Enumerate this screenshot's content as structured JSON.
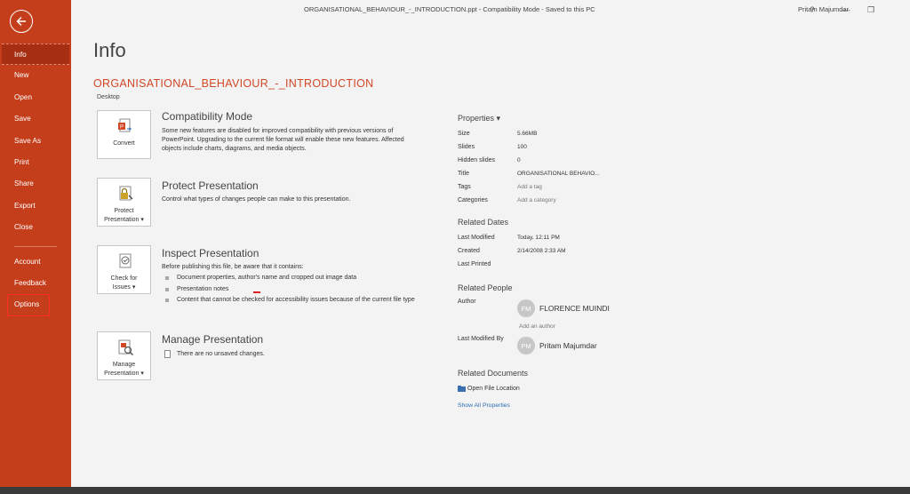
{
  "window": {
    "title": "ORGANISATIONAL_BEHAVIOUR_-_INTRODUCTION.ppt  -  Compatibility Mode  -  Saved to this PC",
    "user": "Pritam Majumdar",
    "help_label": "?",
    "minimize_label": "—",
    "restore_label": "❐"
  },
  "sidebar": {
    "items": [
      {
        "label": "Info"
      },
      {
        "label": "New"
      },
      {
        "label": "Open"
      },
      {
        "label": "Save"
      },
      {
        "label": "Save As"
      },
      {
        "label": "Print"
      },
      {
        "label": "Share"
      },
      {
        "label": "Export"
      },
      {
        "label": "Close"
      }
    ],
    "bottom_items": [
      {
        "label": "Account"
      },
      {
        "label": "Feedback"
      },
      {
        "label": "Options"
      }
    ]
  },
  "page": {
    "title": "Info",
    "file_name": "ORGANISATIONAL_BEHAVIOUR_-_INTRODUCTION",
    "location": "Desktop"
  },
  "sections": {
    "compat": {
      "button_label": "Convert",
      "heading": "Compatibility Mode",
      "description": "Some new features are disabled for improved compatibility with previous versions of PowerPoint. Upgrading to the current file format will enable these new features. Affected objects include charts, diagrams, and media objects."
    },
    "protect": {
      "button_label_1": "Protect",
      "button_label_2": "Presentation ▾",
      "heading": "Protect Presentation",
      "description": "Control what types of changes people can make to this presentation."
    },
    "inspect": {
      "button_label_1": "Check for",
      "button_label_2": "Issues ▾",
      "heading": "Inspect Presentation",
      "intro": "Before publishing this file, be aware that it contains:",
      "bullets": [
        "Document properties, author's name and cropped out image data",
        "Presentation notes",
        "Content that cannot be checked for accessibility issues because of the current file type"
      ]
    },
    "manage": {
      "button_label_1": "Manage",
      "button_label_2": "Presentation ▾",
      "heading": "Manage Presentation",
      "description": "There are no unsaved changes."
    }
  },
  "properties": {
    "heading": "Properties ▾",
    "rows": [
      {
        "label": "Size",
        "value": "5.66MB"
      },
      {
        "label": "Slides",
        "value": "100"
      },
      {
        "label": "Hidden slides",
        "value": "0"
      },
      {
        "label": "Title",
        "value": "ORGANISATIONAL BEHAVIO..."
      },
      {
        "label": "Tags",
        "value": "Add a tag"
      },
      {
        "label": "Categories",
        "value": "Add a category"
      }
    ],
    "dates_heading": "Related Dates",
    "dates": [
      {
        "label": "Last Modified",
        "value": "Today, 12:11 PM"
      },
      {
        "label": "Created",
        "value": "2/14/2008 2:33 AM"
      },
      {
        "label": "Last Printed",
        "value": ""
      }
    ],
    "people_heading": "Related People",
    "author_label": "Author",
    "author_initials": "FM",
    "author_name": "FLORENCE MUINDI",
    "add_author": "Add an author",
    "modified_by_label": "Last Modified By",
    "modifier_initials": "PM",
    "modifier_name": "Pritam Majumdar",
    "docs_heading": "Related Documents",
    "open_location": "Open File Location",
    "show_all": "Show All Properties"
  }
}
